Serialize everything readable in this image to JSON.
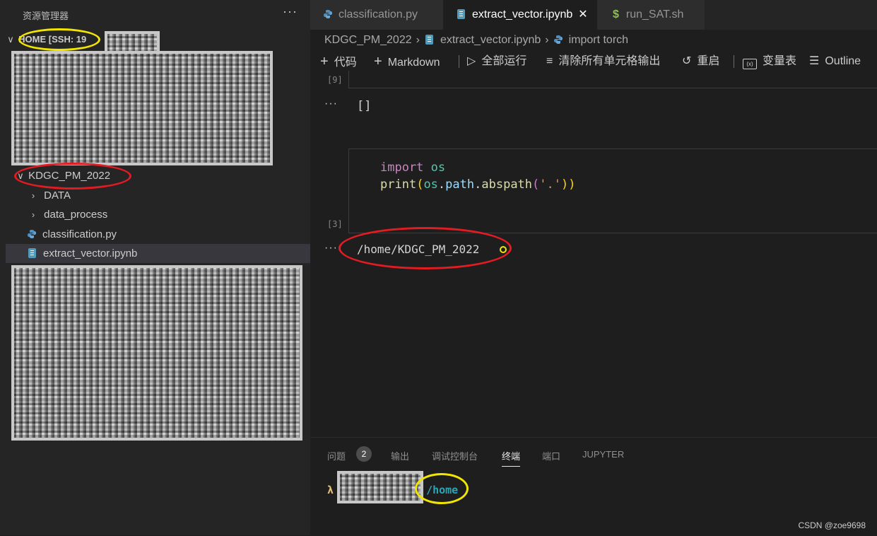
{
  "sidebar": {
    "title": "资源管理器",
    "more": "···",
    "root": {
      "chevron": "∨",
      "label": "HOME [SSH: 19"
    },
    "folder": {
      "chevron": "∨",
      "label": "KDGC_PM_2022"
    },
    "items": [
      {
        "chevron": "›",
        "label": "DATA",
        "kind": "folder"
      },
      {
        "chevron": "›",
        "label": "data_process",
        "kind": "folder"
      },
      {
        "label": "classification.py",
        "kind": "python"
      },
      {
        "label": "extract_vector.ipynb",
        "kind": "notebook",
        "selected": true
      }
    ]
  },
  "tabs": [
    {
      "label": "classification.py",
      "icon": "python-icon"
    },
    {
      "label": "extract_vector.ipynb",
      "icon": "notebook-icon",
      "active": true,
      "close": "✕"
    },
    {
      "label": "run_SAT.sh",
      "icon": "dollar-icon",
      "glyph": "$"
    }
  ],
  "breadcrumb": {
    "folder": "KDGC_PM_2022",
    "file": "extract_vector.ipynb",
    "symbol": "import torch",
    "sep": "›"
  },
  "toolbar": {
    "code": "代码",
    "markdown": "Markdown",
    "run_all": "全部运行",
    "clear": "清除所有单元格输出",
    "restart": "重启",
    "variables": "变量表",
    "outline": "Outline"
  },
  "cells": {
    "prev_prompt": "[9]",
    "prev_output": "[]",
    "prompt": "[3]",
    "code_line1_kw": "import",
    "code_line1_mod": "os",
    "code_line2_fn": "print",
    "code_line2_p1": "(",
    "code_line2_var": "os",
    "code_line2_dot1": ".",
    "code_line2_attr": "path",
    "code_line2_dot2": ".",
    "code_line2_fn2": "abspath",
    "code_line2_p2": "(",
    "code_line2_str": "'.'",
    "code_line2_p3": "))",
    "output": "/home/KDGC_PM_2022",
    "dots": "···"
  },
  "panel": {
    "tabs": [
      "问题",
      "输出",
      "调试控制台",
      "终端",
      "端口",
      "JUPYTER"
    ],
    "problems_count": "2",
    "active_tab": "终端",
    "terminal_lambda": "λ",
    "terminal_host": "08125",
    "terminal_path": "/home"
  },
  "watermark": "CSDN @zoe9698",
  "colors": {
    "highlight_red": "#e31b23",
    "highlight_yellow": "#f2e600",
    "accent": "#519aba"
  }
}
